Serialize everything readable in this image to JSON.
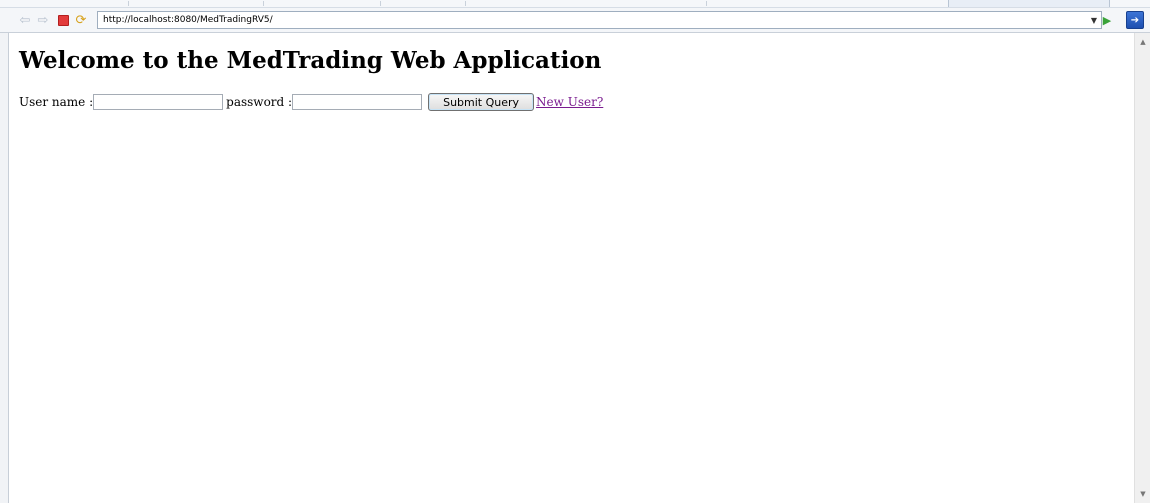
{
  "browser": {
    "url": "http://localhost:8080/MedTradingRV5/",
    "icons": {
      "back": "back-arrow-icon",
      "forward": "forward-arrow-icon",
      "stop": "stop-icon",
      "refresh": "refresh-icon",
      "dropdown": "chevron-down-icon",
      "go": "go-play-icon",
      "exit": "exit-icon"
    }
  },
  "page": {
    "heading": "Welcome to the MedTrading Web Application",
    "login_form": {
      "username_label": "User name :",
      "username_value": "",
      "password_label": "password :",
      "password_value": "",
      "submit_label": "Submit Query",
      "new_user_link": "New User?"
    }
  },
  "colors": {
    "link_visited": "#7a1b8f",
    "toolbar_bg": "#f4f6f9",
    "stop_red": "#e23b3b",
    "go_green": "#3aa33a",
    "exit_blue": "#1d4fb0"
  }
}
